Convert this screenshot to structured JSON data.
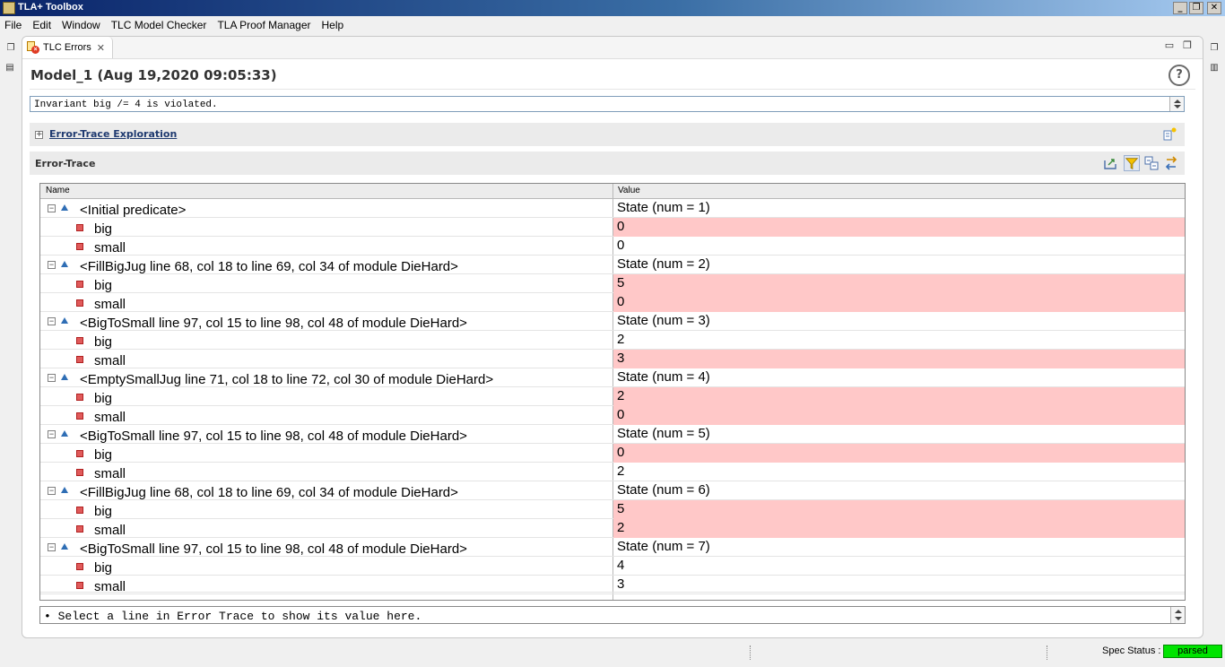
{
  "window": {
    "title": "TLA+ Toolbox"
  },
  "menu": [
    "File",
    "Edit",
    "Window",
    "TLC Model Checker",
    "TLA Proof Manager",
    "Help"
  ],
  "tab": {
    "label": "TLC Errors"
  },
  "form": {
    "title": "Model_1 (Aug 19,2020 09:05:33)",
    "error_message": "Invariant big /= 4 is violated."
  },
  "sections": {
    "exploration": "Error-Trace Exploration",
    "trace": "Error-Trace"
  },
  "table": {
    "columns": [
      "Name",
      "Value"
    ],
    "rows": [
      {
        "kind": "state",
        "name": "<Initial predicate>",
        "value": "State (num = 1)",
        "changed": false
      },
      {
        "kind": "var",
        "name": "big",
        "value": "0",
        "changed": true
      },
      {
        "kind": "var",
        "name": "small",
        "value": "0",
        "changed": false
      },
      {
        "kind": "state",
        "name": "<FillBigJug line 68, col 18 to line 69, col 34 of module DieHard>",
        "value": "State (num = 2)",
        "changed": false
      },
      {
        "kind": "var",
        "name": "big",
        "value": "5",
        "changed": true
      },
      {
        "kind": "var",
        "name": "small",
        "value": "0",
        "changed": true
      },
      {
        "kind": "state",
        "name": "<BigToSmall line 97, col 15 to line 98, col 48 of module DieHard>",
        "value": "State (num = 3)",
        "changed": false
      },
      {
        "kind": "var",
        "name": "big",
        "value": "2",
        "changed": false
      },
      {
        "kind": "var",
        "name": "small",
        "value": "3",
        "changed": true
      },
      {
        "kind": "state",
        "name": "<EmptySmallJug line 71, col 18 to line 72, col 30 of module DieHard>",
        "value": "State (num = 4)",
        "changed": false
      },
      {
        "kind": "var",
        "name": "big",
        "value": "2",
        "changed": true
      },
      {
        "kind": "var",
        "name": "small",
        "value": "0",
        "changed": true
      },
      {
        "kind": "state",
        "name": "<BigToSmall line 97, col 15 to line 98, col 48 of module DieHard>",
        "value": "State (num = 5)",
        "changed": false
      },
      {
        "kind": "var",
        "name": "big",
        "value": "0",
        "changed": true
      },
      {
        "kind": "var",
        "name": "small",
        "value": "2",
        "changed": false
      },
      {
        "kind": "state",
        "name": "<FillBigJug line 68, col 18 to line 69, col 34 of module DieHard>",
        "value": "State (num = 6)",
        "changed": false
      },
      {
        "kind": "var",
        "name": "big",
        "value": "5",
        "changed": true
      },
      {
        "kind": "var",
        "name": "small",
        "value": "2",
        "changed": true
      },
      {
        "kind": "state",
        "name": "<BigToSmall line 97, col 15 to line 98, col 48 of module DieHard>",
        "value": "State (num = 7)",
        "changed": false
      },
      {
        "kind": "var",
        "name": "big",
        "value": "4",
        "changed": false
      },
      {
        "kind": "var",
        "name": "small",
        "value": "3",
        "changed": false
      }
    ]
  },
  "detail": {
    "text": "• Select a line in Error Trace to show its value here."
  },
  "status": {
    "label": "Spec Status :",
    "value": "parsed",
    "value_color": "#00e400"
  },
  "colors": {
    "changed_row": "#ffc8c8",
    "title_bar": "#0a246a"
  }
}
